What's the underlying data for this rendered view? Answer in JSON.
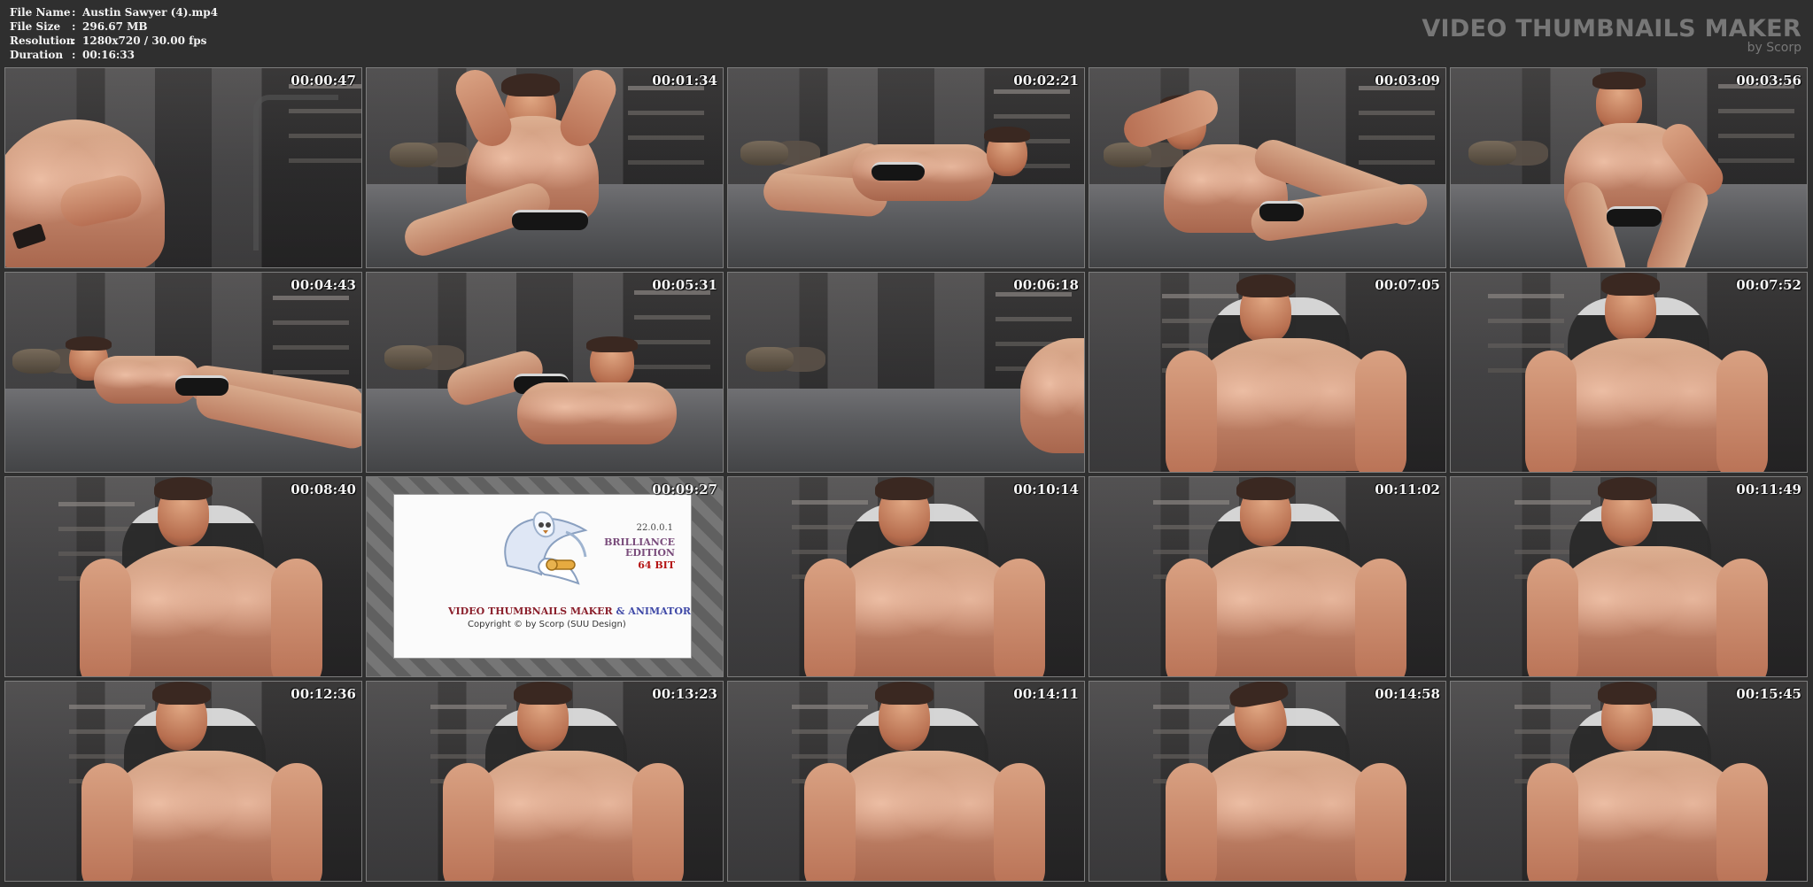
{
  "header": {
    "metadata": [
      {
        "label": "File Name",
        "separator": ":",
        "value": "Austin Sawyer (4).mp4"
      },
      {
        "label": "File Size",
        "separator": ":",
        "value": "296.67 MB"
      },
      {
        "label": "Resolution",
        "separator": ":",
        "value": "1280x720 / 30.00 fps"
      },
      {
        "label": "Duration",
        "separator": ":",
        "value": "00:16:33"
      }
    ],
    "brand_title": "VIDEO THUMBNAILS MAKER",
    "brand_subtitle": "by Scorp"
  },
  "thumbnails": [
    {
      "timestamp": "00:00:47",
      "scene": "closeup-seated"
    },
    {
      "timestamp": "00:01:34",
      "scene": "bed-seated"
    },
    {
      "timestamp": "00:02:21",
      "scene": "bed-lying"
    },
    {
      "timestamp": "00:03:09",
      "scene": "bed-reclining"
    },
    {
      "timestamp": "00:03:56",
      "scene": "bed-seated-2"
    },
    {
      "timestamp": "00:04:43",
      "scene": "bed-lying-2"
    },
    {
      "timestamp": "00:05:31",
      "scene": "bed-prone"
    },
    {
      "timestamp": "00:06:18",
      "scene": "bed-edge"
    },
    {
      "timestamp": "00:07:05",
      "scene": "chair-frontal"
    },
    {
      "timestamp": "00:07:52",
      "scene": "chair-frontal"
    },
    {
      "timestamp": "00:08:40",
      "scene": "chair-frontal"
    },
    {
      "timestamp": "00:09:27",
      "scene": "splash"
    },
    {
      "timestamp": "00:10:14",
      "scene": "chair-frontal"
    },
    {
      "timestamp": "00:11:02",
      "scene": "chair-frontal"
    },
    {
      "timestamp": "00:11:49",
      "scene": "chair-frontal"
    },
    {
      "timestamp": "00:12:36",
      "scene": "chair-frontal"
    },
    {
      "timestamp": "00:13:23",
      "scene": "chair-frontal"
    },
    {
      "timestamp": "00:14:11",
      "scene": "chair-frontal"
    },
    {
      "timestamp": "00:14:58",
      "scene": "chair-frontal"
    },
    {
      "timestamp": "00:15:45",
      "scene": "chair-frontal"
    }
  ],
  "splash": {
    "version": "22.0.0.1",
    "edition": "BRILLIANCE\nEDITION",
    "bitness": "64 BIT",
    "title_main": "VIDEO THUMBNAILS MAKER",
    "title_amp": "& ANIMATOR",
    "copyright": "Copyright © by Scorp (SUU Design)"
  },
  "colors": {
    "page_background": "#2f2f2f",
    "brand_text": "#777777",
    "timestamp_text": "#f6f6f6"
  }
}
